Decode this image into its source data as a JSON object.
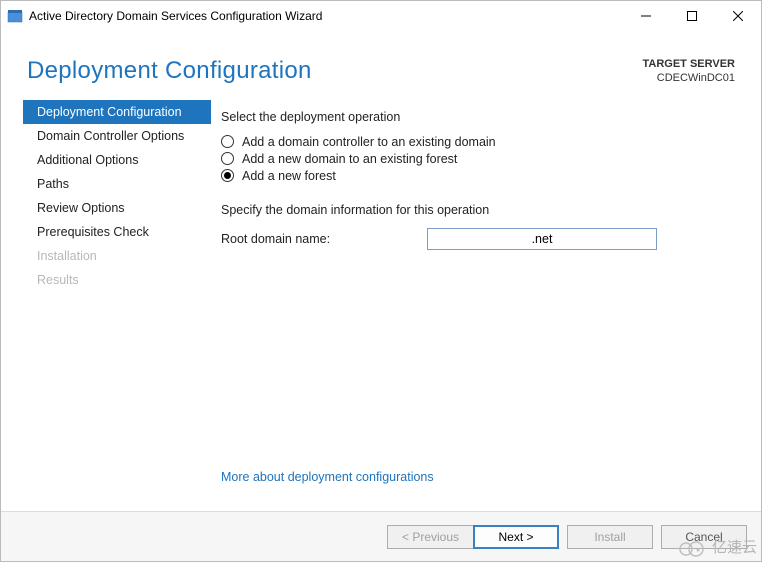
{
  "window": {
    "title": "Active Directory Domain Services Configuration Wizard"
  },
  "header": {
    "title": "Deployment Configuration",
    "target_server_label": "TARGET SERVER",
    "target_server_name": "CDECWinDC01"
  },
  "steps": {
    "items": [
      {
        "label": "Deployment Configuration",
        "state": "active"
      },
      {
        "label": "Domain Controller Options",
        "state": "normal"
      },
      {
        "label": "Additional Options",
        "state": "normal"
      },
      {
        "label": "Paths",
        "state": "normal"
      },
      {
        "label": "Review Options",
        "state": "normal"
      },
      {
        "label": "Prerequisites Check",
        "state": "normal"
      },
      {
        "label": "Installation",
        "state": "disabled"
      },
      {
        "label": "Results",
        "state": "disabled"
      }
    ]
  },
  "content": {
    "select_op_label": "Select the deployment operation",
    "radios": {
      "existing_domain": "Add a domain controller to an existing domain",
      "existing_forest": "Add a new domain to an existing forest",
      "new_forest": "Add a new forest"
    },
    "specify_label": "Specify the domain information for this operation",
    "root_domain_label": "Root domain name:",
    "root_domain_value": ".net",
    "more_link": "More about deployment configurations"
  },
  "footer": {
    "previous": "< Previous",
    "next": "Next >",
    "install": "Install",
    "cancel": "Cancel"
  },
  "watermark": {
    "text": "亿速云"
  }
}
